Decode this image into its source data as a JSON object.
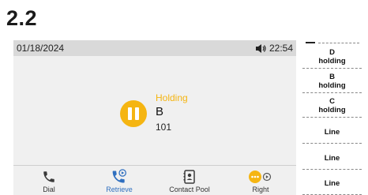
{
  "section": {
    "number": "2.2"
  },
  "status_bar": {
    "date": "01/18/2024",
    "time": "22:54"
  },
  "call": {
    "status": "Holding",
    "name": "B",
    "number": "101"
  },
  "softkeys": [
    {
      "label": "Dial",
      "icon": "phone-icon"
    },
    {
      "label": "Retrieve",
      "icon": "retrieve-call-icon"
    },
    {
      "label": "Contact Pool",
      "icon": "contacts-icon"
    },
    {
      "label": "Right",
      "icon": "more-right-icon"
    }
  ],
  "line_keys": [
    {
      "line1": "D",
      "line2": "holding"
    },
    {
      "line1": "B",
      "line2": "holding"
    },
    {
      "line1": "C",
      "line2": "holding"
    },
    {
      "line1": "Line",
      "line2": ""
    },
    {
      "line1": "Line",
      "line2": ""
    },
    {
      "line1": "Line",
      "line2": ""
    }
  ],
  "colors": {
    "accent": "#f5b512",
    "active": "#2f6fbf",
    "statusbar": "#d9d9d9",
    "screen": "#f0f0f0"
  }
}
